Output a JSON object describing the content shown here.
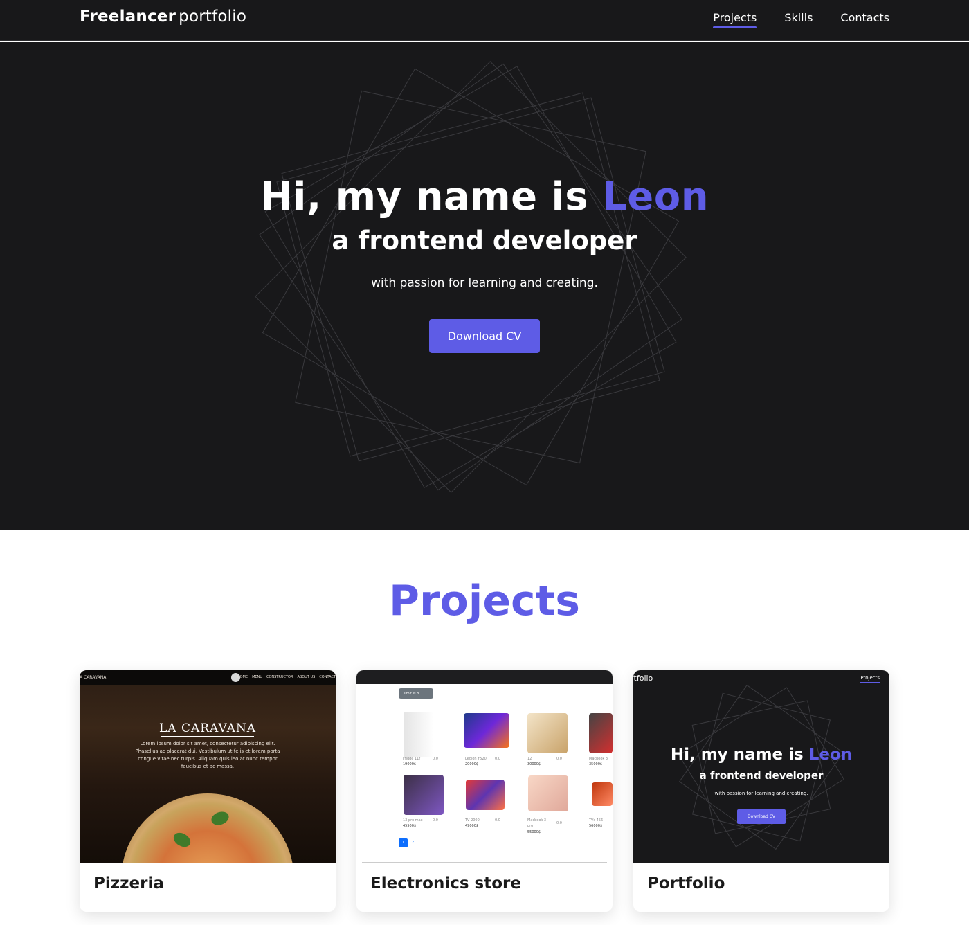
{
  "header": {
    "logo_bold": "Freelancer",
    "logo_thin": "portfolio",
    "nav": [
      {
        "label": "Projects",
        "active": true
      },
      {
        "label": "Skills",
        "active": false
      },
      {
        "label": "Contacts",
        "active": false
      }
    ]
  },
  "hero": {
    "title_prefix": "Hi, my name is ",
    "title_name": "Leon",
    "subtitle": "a frontend developer",
    "description": "with passion for learning and creating.",
    "cv_button": "Download CV"
  },
  "projects": {
    "heading": "Projects",
    "cards": [
      {
        "title": "Pizzeria",
        "preview": {
          "brand": "A CARAVANA",
          "nav": [
            "HOME",
            "MENU",
            "CONSTRUCTOR",
            "ABOUT US",
            "CONTACT"
          ],
          "heading": "LA CARAVANA",
          "text": "Lorem ipsum dolor sit amet, consectetur adipiscing elit. Phasellus ac placerat dui. Vestibulum ut felis et lorem porta congue vitae nec turpis. Aliquam quis leo at nunc tempor faucibus et ac massa."
        }
      },
      {
        "title": "Electronics store",
        "preview": {
          "limit": "limit is 8",
          "products": [
            {
              "name": "Fridge 11f",
              "price": "19000$",
              "rating": "0.0"
            },
            {
              "name": "Legion Y520",
              "price": "20000$",
              "rating": "0.0"
            },
            {
              "name": "12",
              "price": "30000$",
              "rating": "0.0"
            },
            {
              "name": "Macbook 3",
              "price": "35000$",
              "rating": ""
            },
            {
              "name": "13 pro max",
              "price": "45500$",
              "rating": "0.0"
            },
            {
              "name": "TV 2000",
              "price": "49000$",
              "rating": "0.0"
            },
            {
              "name": "Macbook 3 pro",
              "price": "55000$",
              "rating": "0.0"
            },
            {
              "name": "TVs 456",
              "price": "56000$",
              "rating": ""
            }
          ],
          "pages": [
            "1",
            "2"
          ]
        }
      },
      {
        "title": "Portfolio",
        "preview": {
          "logo": "rtfolio",
          "nav": "Projects",
          "title_prefix": "Hi, my name is ",
          "title_name": "Leon",
          "subtitle": "a frontend developer",
          "description": "with passion for learning and creating.",
          "button": "Download CV"
        }
      }
    ]
  },
  "colors": {
    "accent": "#5e5ce6",
    "dark_bg": "#18181a",
    "light_bg": "#ffffff"
  }
}
